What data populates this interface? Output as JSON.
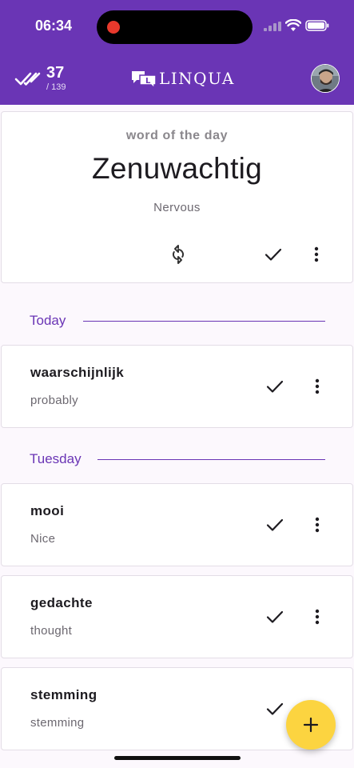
{
  "status": {
    "time": "06:34"
  },
  "header": {
    "count": "37",
    "total": "/ 139",
    "app_name": "LINQUA",
    "logo_letter": "L"
  },
  "word_of_day": {
    "label": "word of the day",
    "word": "Zenuwachtig",
    "translation": "Nervous"
  },
  "sections": [
    {
      "title": "Today",
      "items": [
        {
          "word": "waarschijnlijk",
          "translation": "probably"
        }
      ]
    },
    {
      "title": "Tuesday",
      "items": [
        {
          "word": "mooi",
          "translation": "Nice"
        },
        {
          "word": "gedachte",
          "translation": "thought"
        },
        {
          "word": "stemming",
          "translation": "stemming"
        }
      ]
    }
  ],
  "fab": {
    "icon": "plus-icon"
  },
  "colors": {
    "primary": "#6a35b5",
    "fab": "#fcd440",
    "background": "#fcf8fd"
  }
}
